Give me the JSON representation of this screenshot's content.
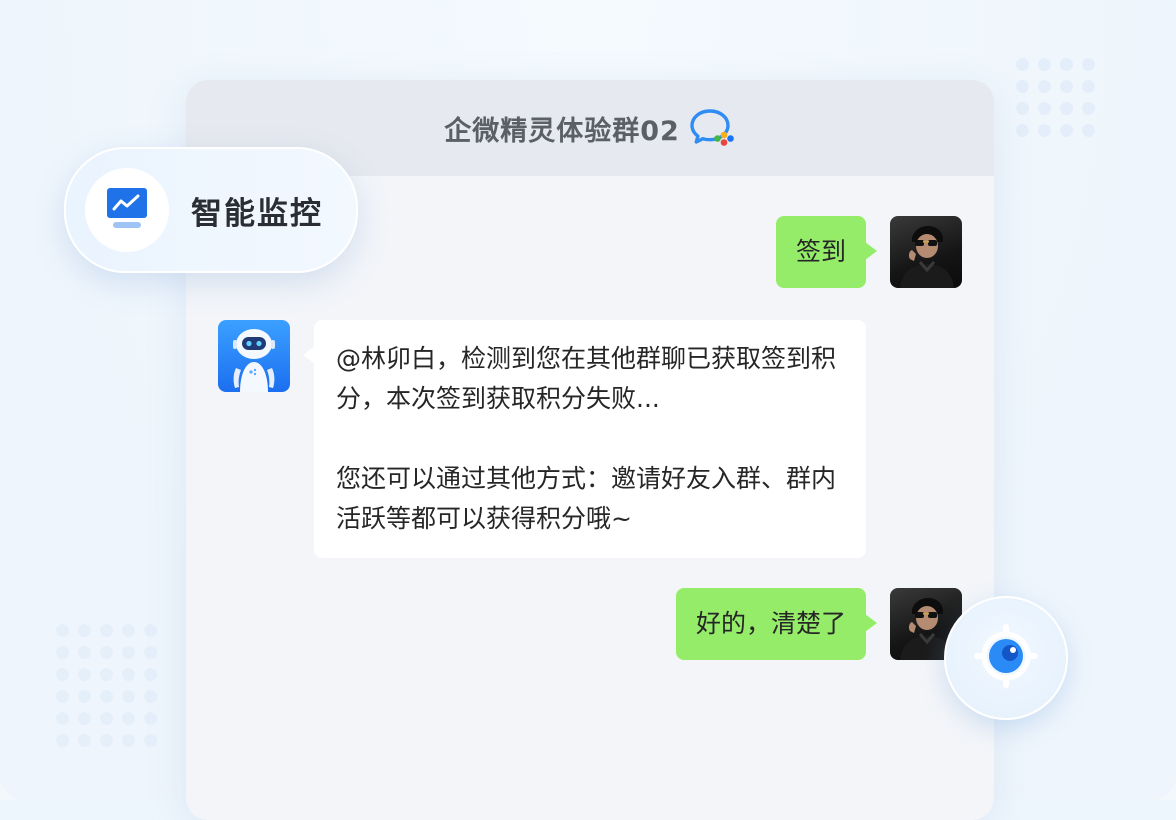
{
  "chat": {
    "title": "企微精灵体验群02",
    "group_icon": "group-chat-icon"
  },
  "feature_badge": {
    "icon": "monitor-chart-icon",
    "label": "智能监控"
  },
  "messages": [
    {
      "sender": "user",
      "avatar": "user-avatar",
      "text": "签到"
    },
    {
      "sender": "bot",
      "avatar": "robot-avatar",
      "paragraphs": [
        "@林卯白，检测到您在其他群聊已获取签到积分，本次签到获取积分失败...",
        "您还可以通过其他方式：邀请好友入群、群内活跃等都可以获得积分哦~"
      ]
    },
    {
      "sender": "user",
      "avatar": "user-avatar",
      "text": "好的，清楚了"
    }
  ],
  "floating_button": {
    "icon": "eye-target-icon"
  },
  "colors": {
    "user_bubble": "#95ec69",
    "bot_bubble": "#ffffff",
    "header_bg": "#e6e9ef",
    "chat_bg": "#f3f5f9",
    "accent_blue": "#1a73f0"
  }
}
